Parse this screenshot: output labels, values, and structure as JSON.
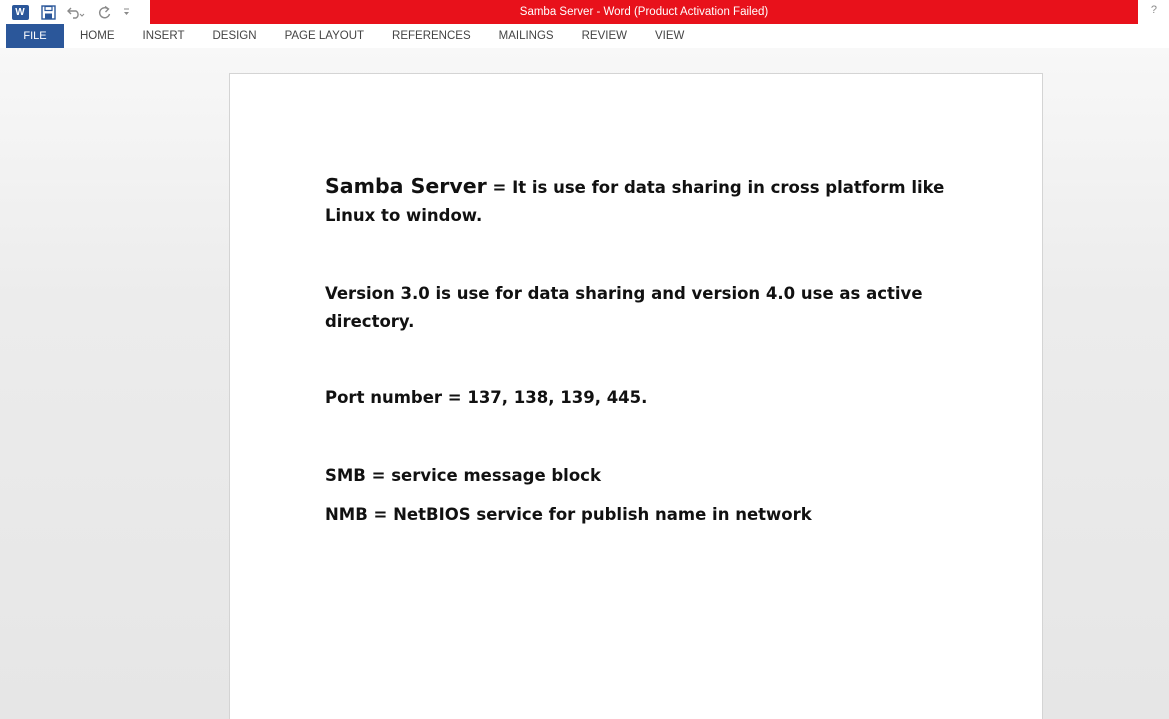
{
  "window": {
    "title": "Samba Server -  Word (Product Activation Failed)",
    "help": "?",
    "word_logo": "W"
  },
  "qat": {
    "icons": [
      "word-icon",
      "save-icon",
      "undo-icon",
      "redo-icon",
      "customize-icon"
    ]
  },
  "ribbon": {
    "tabs": {
      "file": "FILE",
      "home": "HOME",
      "insert": "INSERT",
      "design": "DESIGN",
      "page_layout": "PAGE LAYOUT",
      "references": "REFERENCES",
      "mailings": "MAILINGS",
      "review": "REVIEW",
      "view": "VIEW"
    }
  },
  "document": {
    "heading_bold": "Samba Server",
    "heading_rest": " = It is use for data sharing in cross platform like Linux to window.",
    "para_version": "Version 3.0 is use for data sharing and version 4.0 use as active directory.",
    "para_port": "Port number = 137, 138, 139, 445.",
    "para_smb": "SMB = service message block",
    "para_nmb": "NMB = NetBIOS service for publish name in network"
  },
  "colors": {
    "title_bar_red": "#e8111b",
    "file_tab_blue": "#2b579a"
  }
}
